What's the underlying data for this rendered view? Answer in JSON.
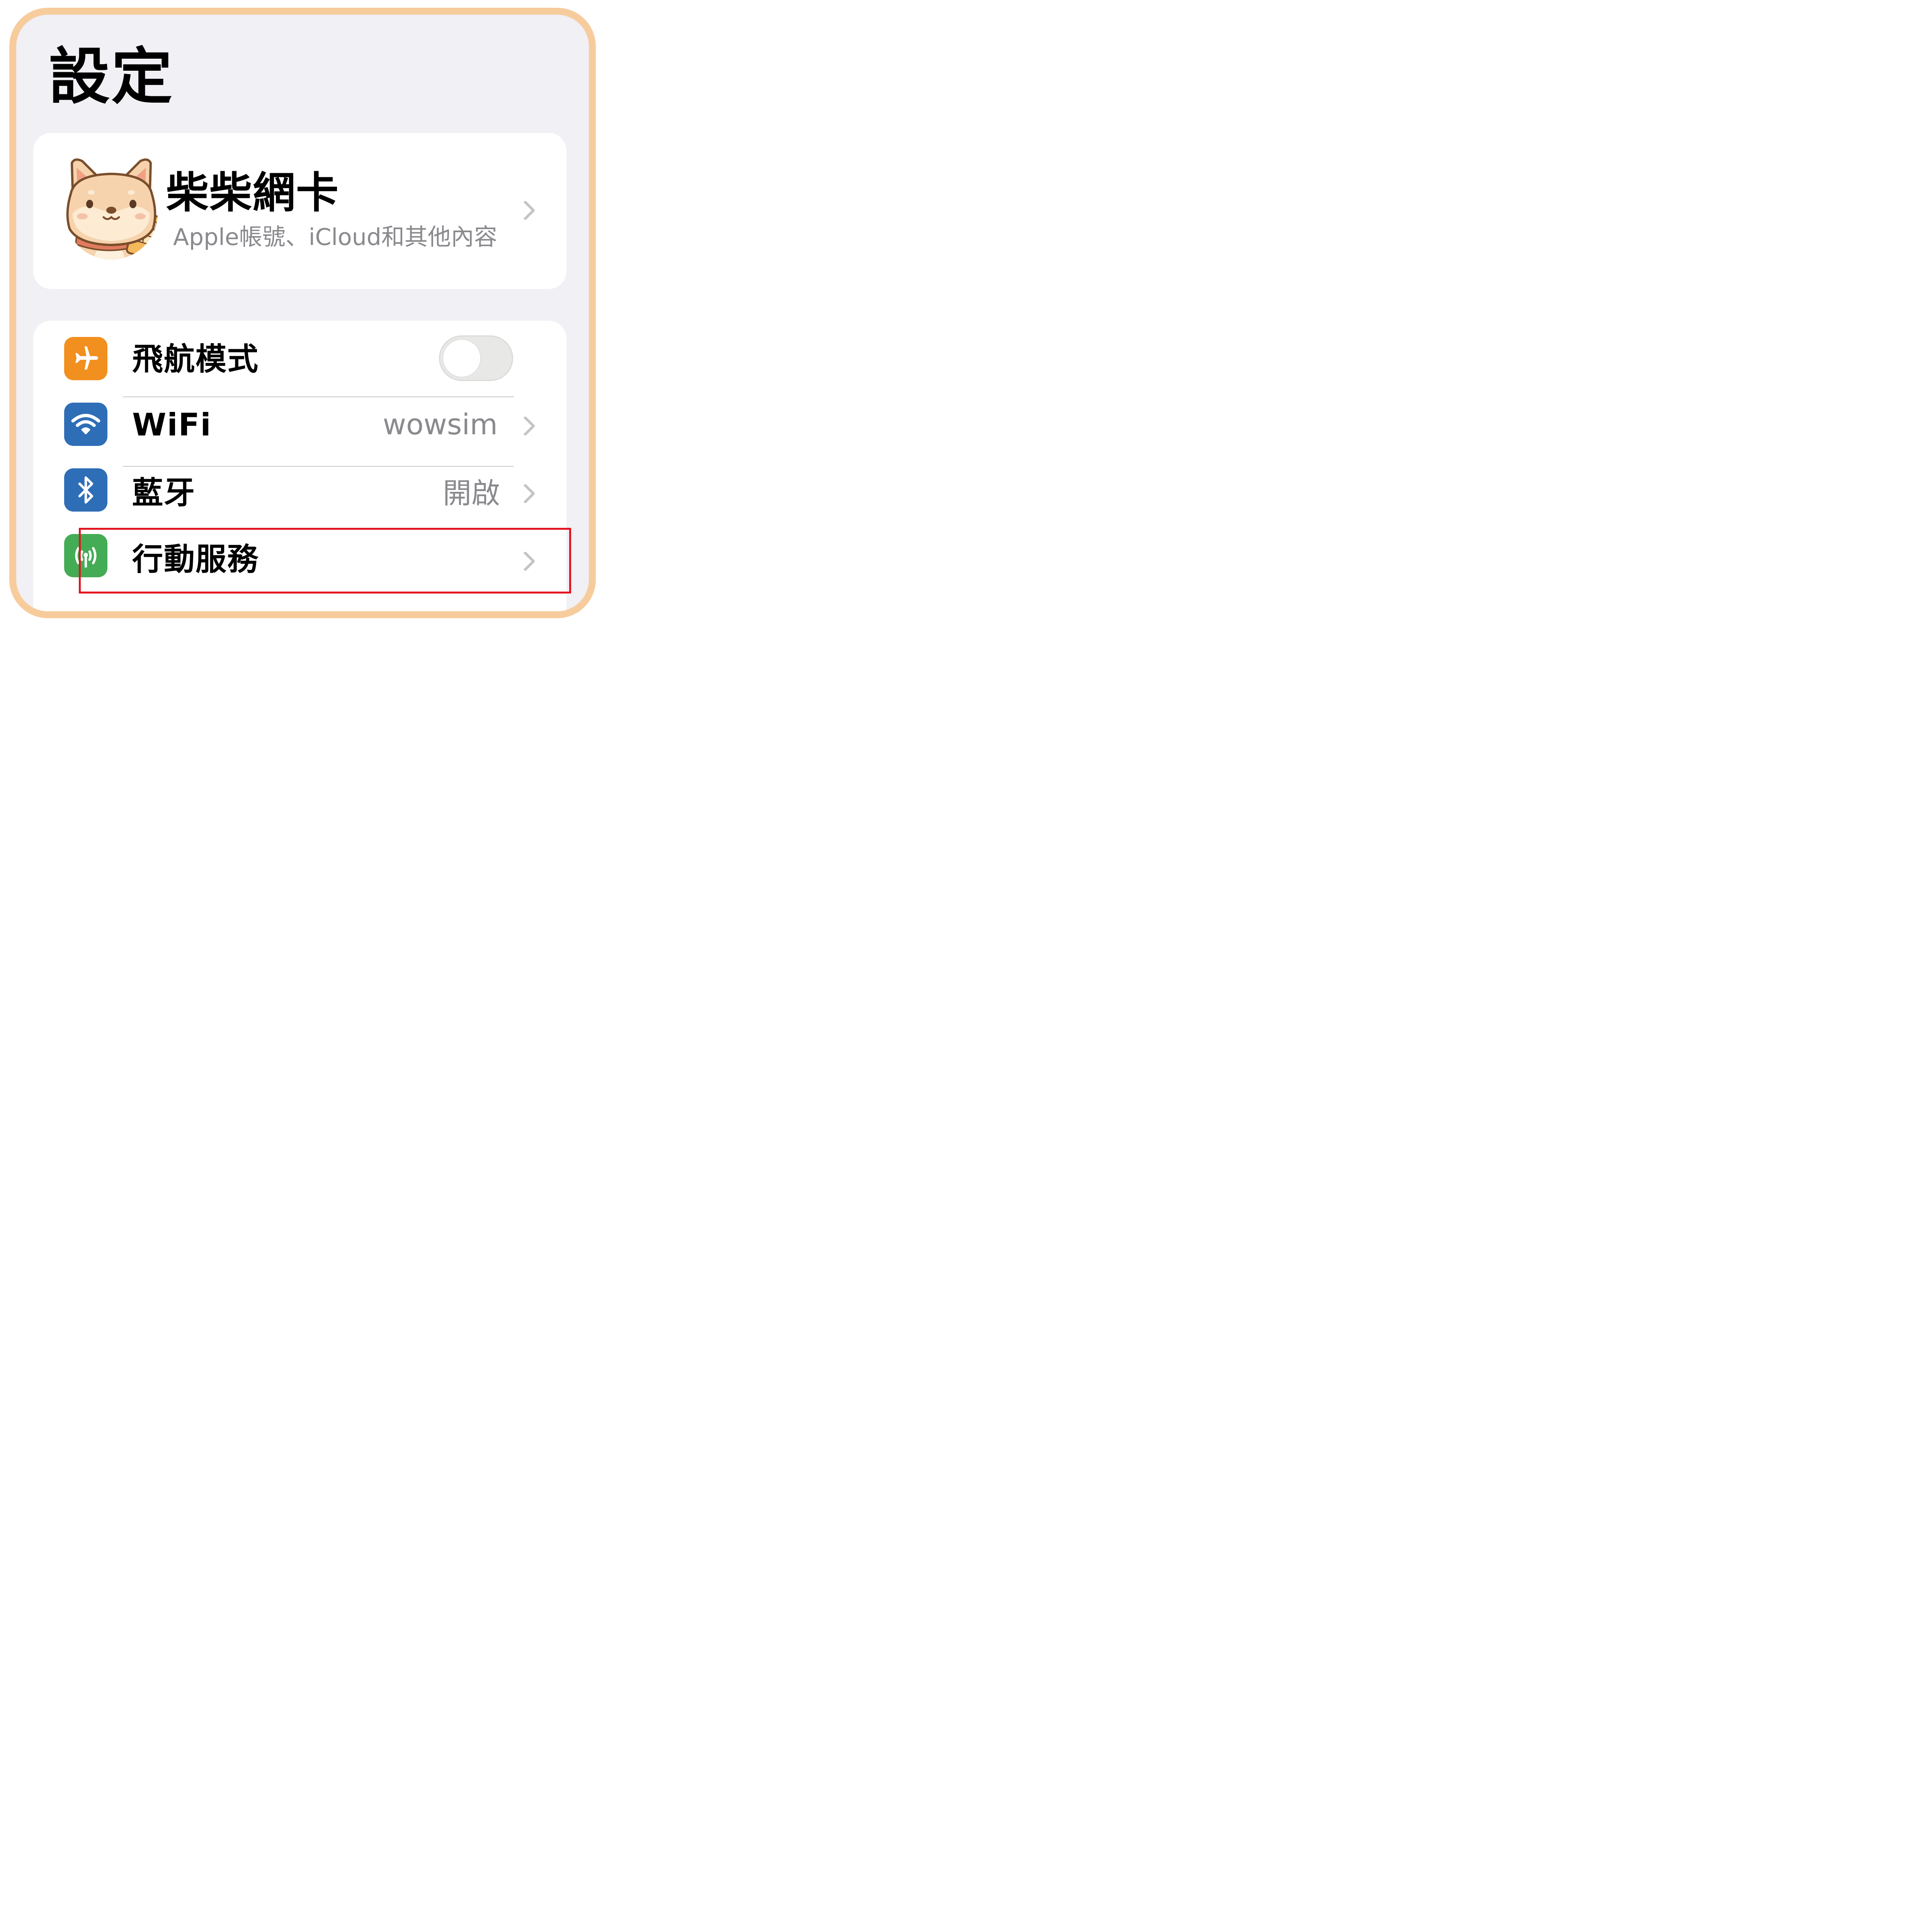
{
  "header": {
    "title": "設定"
  },
  "profile": {
    "name": "柴柴網卡",
    "subtitle": "Apple帳號、iCloud和其他內容",
    "avatar_icon": "shiba-dog-avatar"
  },
  "settings": {
    "rows": [
      {
        "label": "飛航模式",
        "icon": "airplane-icon",
        "icon_color": "#f18f1f",
        "control": "toggle",
        "toggle_on": false
      },
      {
        "label": "WiFi",
        "icon": "wifi-icon",
        "icon_color": "#2e6eb7",
        "value": "wowsim"
      },
      {
        "label": "藍牙",
        "icon": "bluetooth-icon",
        "icon_color": "#2e6eb7",
        "value": "開啟"
      },
      {
        "label": "行動服務",
        "icon": "cellular-antenna-icon",
        "icon_color": "#44ac55",
        "highlighted": true
      }
    ]
  },
  "colors": {
    "frame_border": "#f7cc9d",
    "background": "#f0f0f5",
    "highlight": "#e3141f"
  }
}
